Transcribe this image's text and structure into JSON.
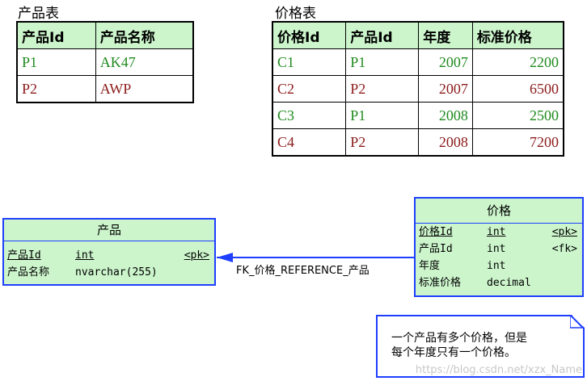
{
  "product_table": {
    "caption": "产品表",
    "headers": [
      "产品Id",
      "产品名称"
    ],
    "rows": [
      {
        "id": "P1",
        "name": "AK47"
      },
      {
        "id": "P2",
        "name": "AWP"
      }
    ]
  },
  "price_table": {
    "caption": "价格表",
    "headers": [
      "价格Id",
      "产品Id",
      "年度",
      "标准价格"
    ],
    "rows": [
      {
        "price_id": "C1",
        "product_id": "P1",
        "year": "2007",
        "price": "2200"
      },
      {
        "price_id": "C2",
        "product_id": "P2",
        "year": "2007",
        "price": "6500"
      },
      {
        "price_id": "C3",
        "product_id": "P1",
        "year": "2008",
        "price": "2500"
      },
      {
        "price_id": "C4",
        "product_id": "P2",
        "year": "2008",
        "price": "7200"
      }
    ]
  },
  "entity_product": {
    "title": "产品",
    "fields": [
      {
        "name": "产品Id",
        "type": "int",
        "key": "<pk>"
      },
      {
        "name": "产品名称",
        "type": "nvarchar(255)",
        "key": ""
      }
    ]
  },
  "entity_price": {
    "title": "价格",
    "fields": [
      {
        "name": "价格Id",
        "type": "int",
        "key": "<pk>"
      },
      {
        "name": "产品Id",
        "type": "int",
        "key": "<fk>"
      },
      {
        "name": "年度",
        "type": "int",
        "key": ""
      },
      {
        "name": "标准价格",
        "type": "decimal",
        "key": ""
      }
    ]
  },
  "relationship": {
    "label": "FK_价格_REFERENCE_产品"
  },
  "note": {
    "line1": "一个产品有多个价格，但是",
    "line2": "每个年度只有一个价格。"
  },
  "watermark": "https://blog.csdn.net/xzx_Name",
  "colors": {
    "header_bg": "#ccf5cc",
    "entity_border": "#1e3fff",
    "green_text": "#1f8a1f",
    "red_text": "#8b1a1a"
  }
}
